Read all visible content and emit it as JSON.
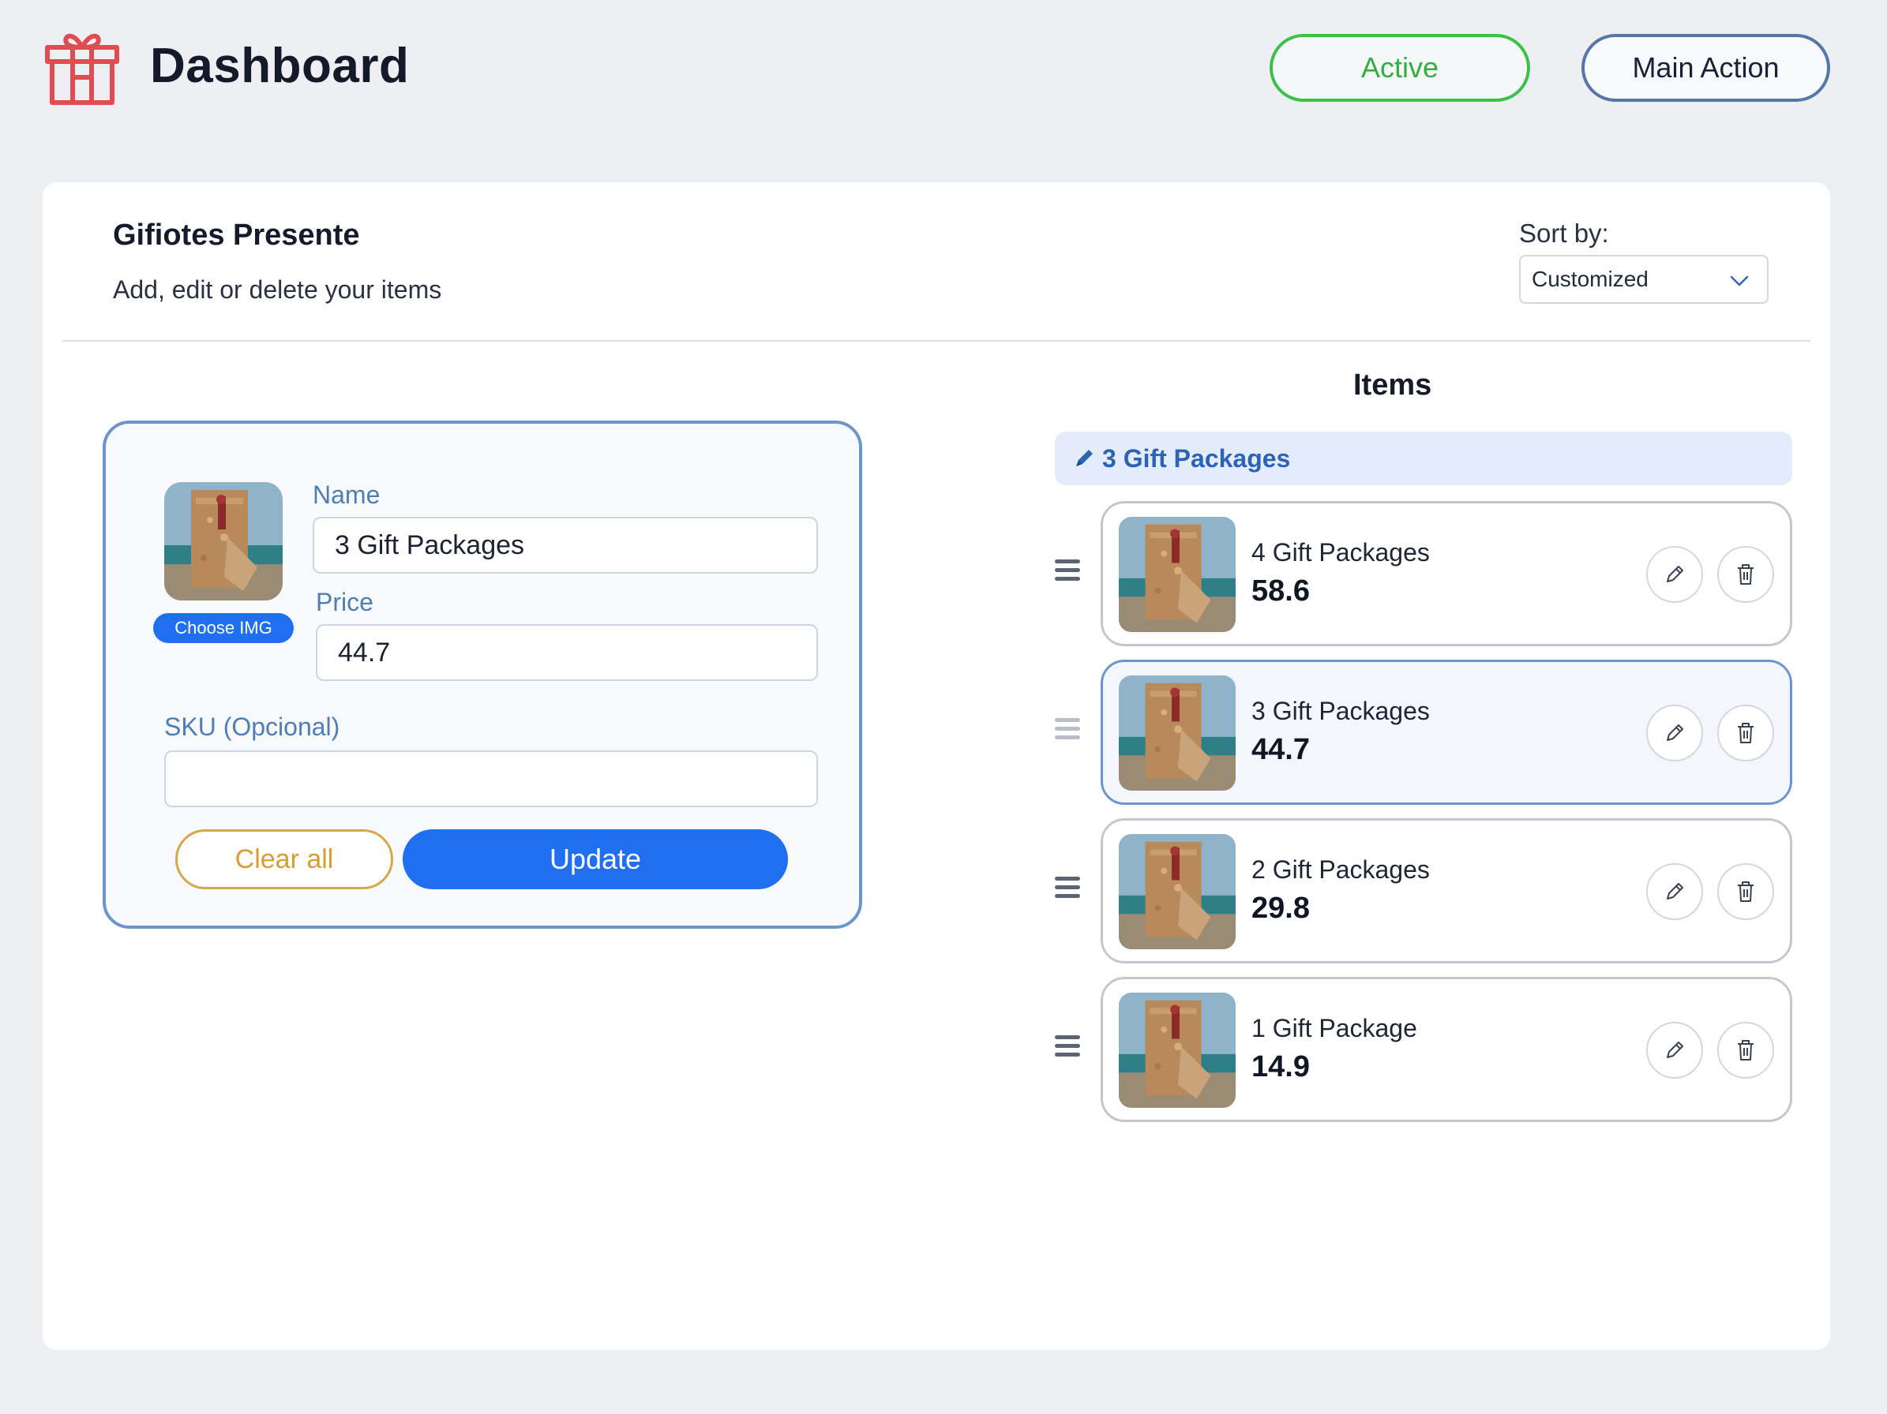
{
  "header": {
    "app_title": "Dashboard",
    "active_label": "Active",
    "main_action_label": "Main Action"
  },
  "colors": {
    "brand_blue": "#1f6ff0",
    "active_green": "#3bc14a",
    "clear_amber": "#d9a64a",
    "logo_red": "#e14b52"
  },
  "section": {
    "title": "Gifiotes Presente",
    "subtitle": "Add, edit or delete your items",
    "sort_label": "Sort by:",
    "sort_value": "Customized"
  },
  "form": {
    "choose_img_label": "Choose IMG",
    "name_label": "Name",
    "name_value": "3 Gift Packages",
    "price_label": "Price",
    "price_value": "44.7",
    "sku_label": "SKU (Opcional)",
    "sku_value": "",
    "clear_label": "Clear all",
    "update_label": "Update"
  },
  "items": {
    "title": "Items",
    "selected_label": "3 Gift Packages",
    "list": [
      {
        "name": "4 Gift Packages",
        "price": "58.6",
        "selected": false
      },
      {
        "name": "3 Gift Packages",
        "price": "44.7",
        "selected": true
      },
      {
        "name": "2 Gift Packages",
        "price": "29.8",
        "selected": false
      },
      {
        "name": "1 Gift Package",
        "price": "14.9",
        "selected": false
      }
    ]
  },
  "icons": [
    "gift-icon",
    "chevron-down-icon",
    "pencil-icon",
    "drag-handle-icon",
    "edit-icon",
    "trash-icon"
  ]
}
